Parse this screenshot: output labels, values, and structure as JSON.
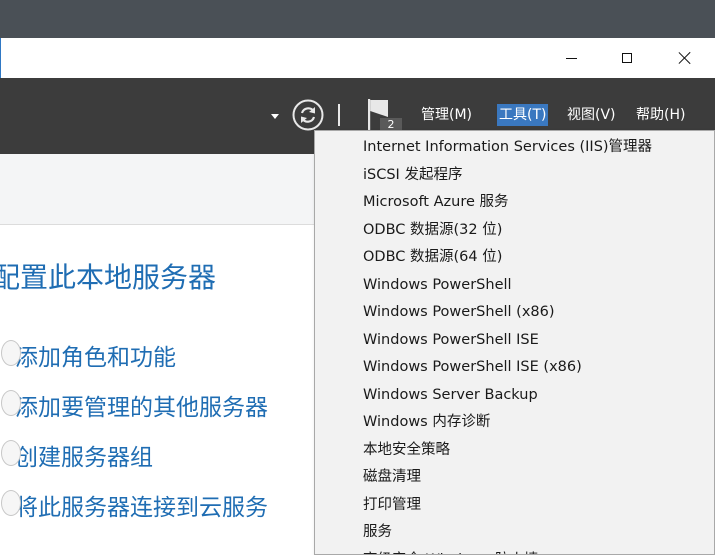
{
  "window": {
    "controls": {
      "minimize_icon": "minimize-icon",
      "maximize_icon": "maximize-icon",
      "close_icon": "close-icon"
    }
  },
  "toolbar": {
    "notification_count": "2",
    "menus": [
      {
        "label": "管理(M)",
        "active": false
      },
      {
        "label": "工具(T)",
        "active": true
      },
      {
        "label": "视图(V)",
        "active": false
      },
      {
        "label": "帮助(H)",
        "active": false
      }
    ]
  },
  "main": {
    "section_title": "配置此本地服务器",
    "tasks": [
      "添加角色和功能",
      "添加要管理的其他服务器",
      "创建服务器组",
      "将此服务器连接到云服务"
    ]
  },
  "tools_menu": {
    "items": [
      "Internet Information Services (IIS)管理器",
      "iSCSI 发起程序",
      "Microsoft Azure 服务",
      "ODBC 数据源(32 位)",
      "ODBC 数据源(64 位)",
      "Windows PowerShell",
      "Windows PowerShell (x86)",
      "Windows PowerShell ISE",
      "Windows PowerShell ISE (x86)",
      "Windows Server Backup",
      "Windows 内存诊断",
      "本地安全策略",
      "磁盘清理",
      "打印管理",
      "服务",
      "高级安全 Windows 防火墙"
    ]
  },
  "colors": {
    "accent": "#3a78c0",
    "link": "#1f6db3",
    "toolbar_bg": "#3c3c3c"
  }
}
